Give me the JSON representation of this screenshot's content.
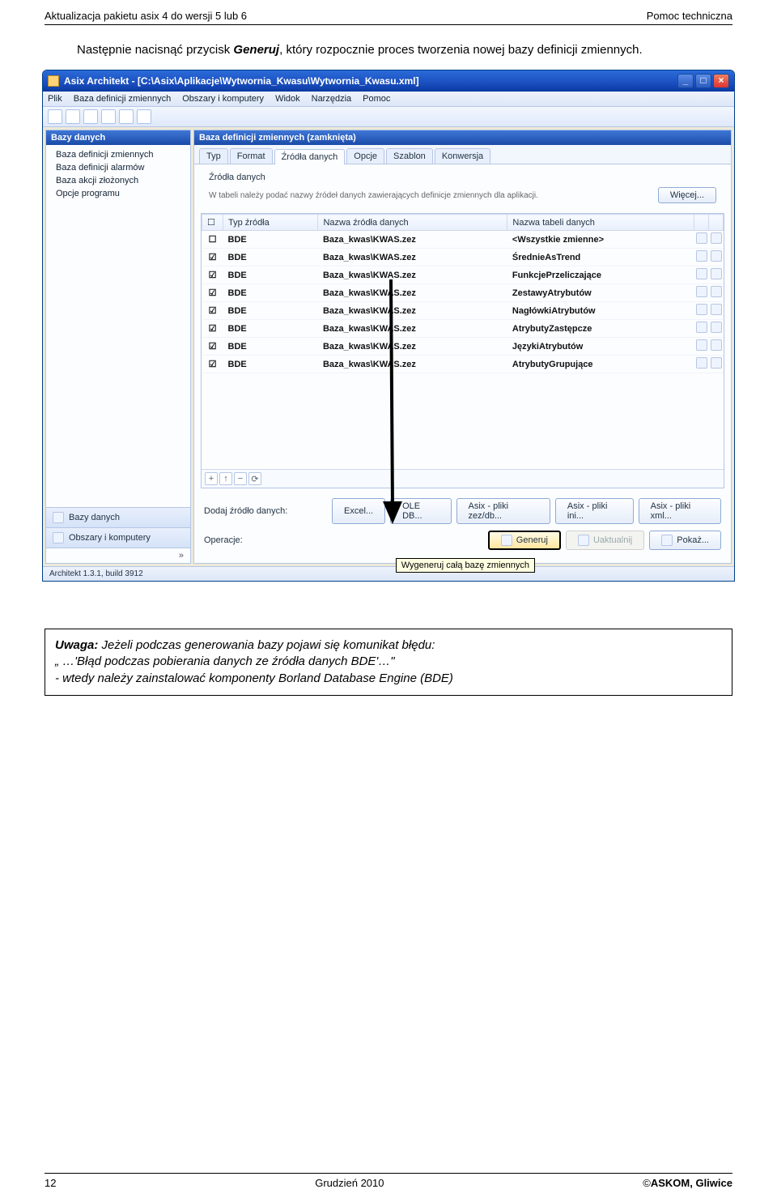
{
  "header": {
    "left": "Aktualizacja pakietu asix 4 do wersji 5 lub 6",
    "right": "Pomoc techniczna"
  },
  "paragraph": {
    "pre": "Następnie nacisnąć przycisk ",
    "bold": "Generuj",
    "post": ", który rozpocznie proces tworzenia nowej bazy definicji zmiennych."
  },
  "window": {
    "title": "Asix Architekt - [C:\\Asix\\Aplikacje\\Wytwornia_Kwasu\\Wytwornia_Kwasu.xml]",
    "menu": [
      "Plik",
      "Baza definicji zmiennych",
      "Obszary i komputery",
      "Widok",
      "Narzędzia",
      "Pomoc"
    ],
    "sidebar_title": "Bazy danych",
    "sidebar_items": [
      "Baza definicji zmiennych",
      "Baza definicji alarmów",
      "Baza akcji złożonych",
      "Opcje programu"
    ],
    "sidebar_bottom": [
      "Bazy danych",
      "Obszary i komputery"
    ],
    "main_title": "Baza definicji zmiennych (zamknięta)",
    "tabs": [
      "Typ",
      "Format",
      "Źródła danych",
      "Opcje",
      "Szablon",
      "Konwersja"
    ],
    "section_caption": "Źródła danych",
    "help_text": "W tabeli należy podać nazwy źródeł danych zawierających definicje zmiennych dla aplikacji.",
    "wiecej": "Więcej...",
    "columns": [
      "Typ źródła",
      "Nazwa źródła danych",
      "Nazwa tabeli danych"
    ],
    "rows": [
      {
        "chk": false,
        "type": "BDE",
        "name": "Baza_kwas\\KWAS.zez",
        "table": "<Wszystkie zmienne>"
      },
      {
        "chk": true,
        "type": "BDE",
        "name": "Baza_kwas\\KWAS.zez",
        "table": "ŚrednieAsTrend"
      },
      {
        "chk": true,
        "type": "BDE",
        "name": "Baza_kwas\\KWAS.zez",
        "table": "FunkcjePrzeliczające"
      },
      {
        "chk": true,
        "type": "BDE",
        "name": "Baza_kwas\\KWAS.zez",
        "table": "ZestawyAtrybutów"
      },
      {
        "chk": true,
        "type": "BDE",
        "name": "Baza_kwas\\KWAS.zez",
        "table": "NagłówkiAtrybutów"
      },
      {
        "chk": true,
        "type": "BDE",
        "name": "Baza_kwas\\KWAS.zez",
        "table": "AtrybutyZastępcze"
      },
      {
        "chk": true,
        "type": "BDE",
        "name": "Baza_kwas\\KWAS.zez",
        "table": "JęzykiAtrybutów"
      },
      {
        "chk": true,
        "type": "BDE",
        "name": "Baza_kwas\\KWAS.zez",
        "table": "AtrybutyGrupujące"
      }
    ],
    "addrow_label": "Dodaj źródło danych:",
    "add_buttons": [
      "Excel...",
      "OLE DB...",
      "Asix - pliki zez/db...",
      "Asix - pliki ini...",
      "Asix - pliki xml..."
    ],
    "ops_label": "Operacje:",
    "ops_buttons": {
      "generate": "Generuj",
      "update": "Uaktualnij",
      "show": "Pokaż..."
    },
    "tooltip": "Wygeneruj całą bazę zmiennych",
    "status_left": "Architekt 1.3.1, build 3912"
  },
  "note": {
    "l1a": "Uwaga:",
    "l1b": " Jeżeli podczas generowania bazy pojawi się komunikat błędu:",
    "l2": "„ …'Błąd podczas pobierania danych ze źródła danych BDE'…\"",
    "l3": "- wtedy należy zainstalować komponenty Borland Database Engine (BDE)"
  },
  "footer": {
    "page": "12",
    "center": "Grudzień 2010",
    "right": "ASKOM, Gliwice"
  }
}
